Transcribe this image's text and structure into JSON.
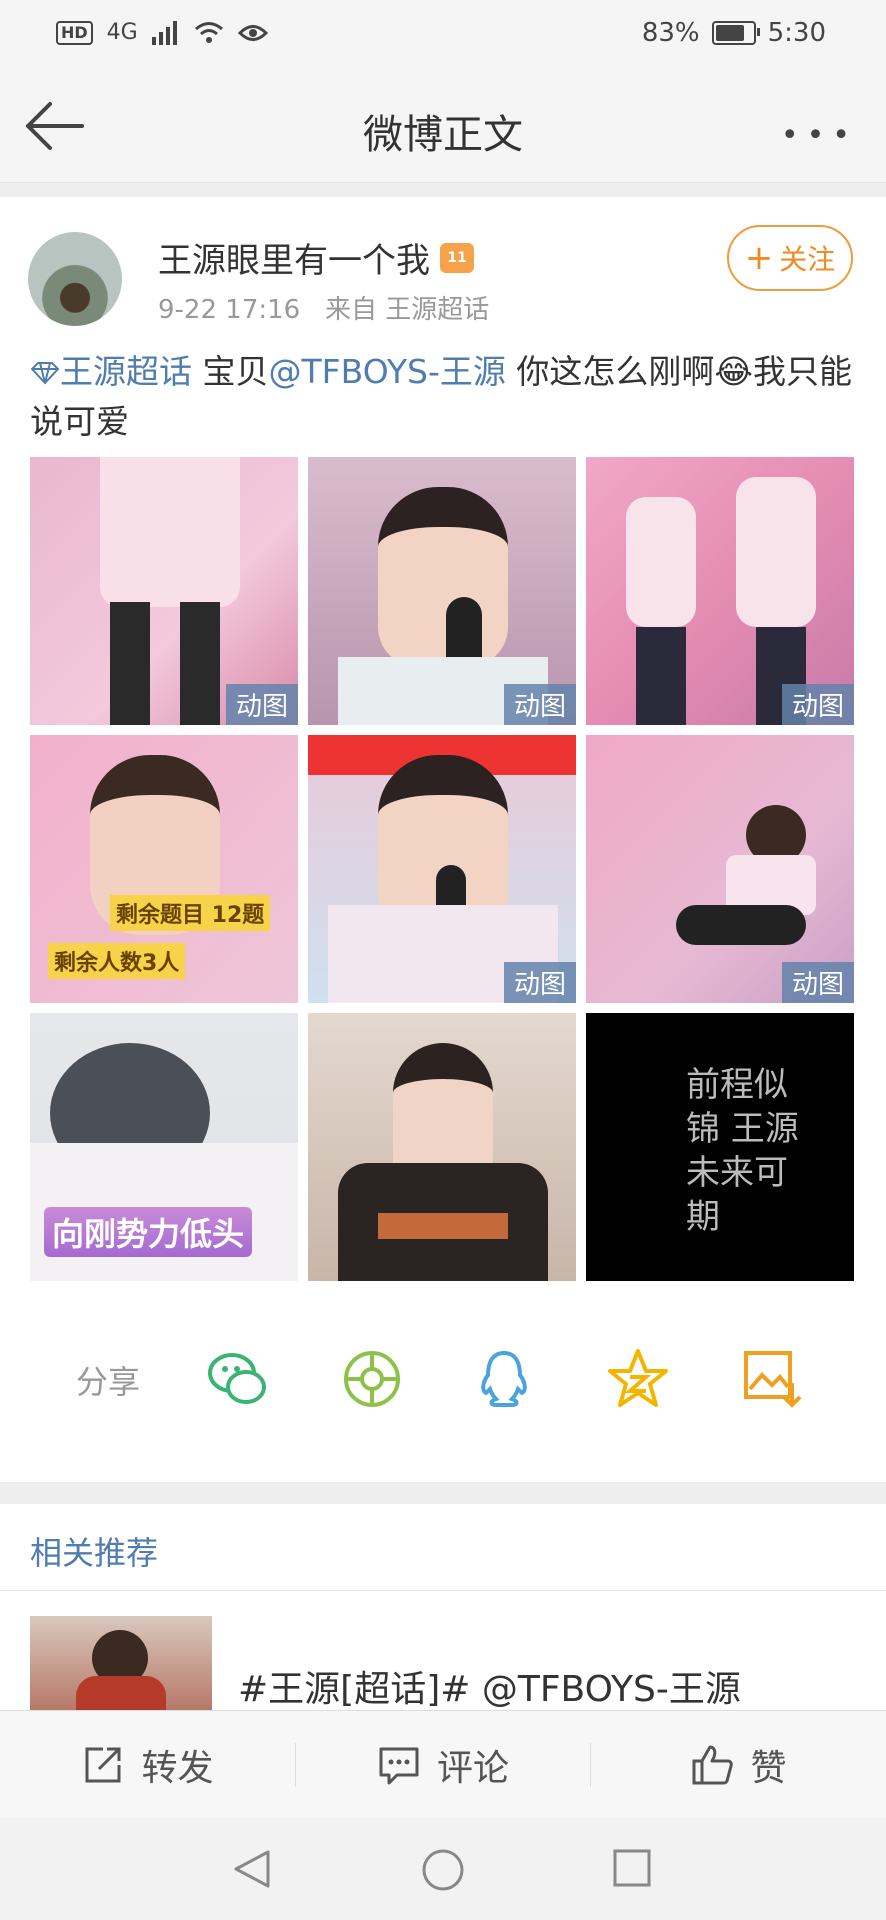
{
  "status_bar": {
    "hd": "HD",
    "network": "4G",
    "battery_percent": "83%",
    "battery_level": 0.83,
    "time": "5:30"
  },
  "nav": {
    "title": "微博正文"
  },
  "post": {
    "username": "王源眼里有一个我",
    "badge": "11",
    "time": "9-22 17:16",
    "source": "来自 王源超话",
    "follow_label": "关注",
    "topic_link": "王源超话",
    "text_before": " 宝贝",
    "mention": "@TFBOYS-王源",
    "text_after": " 你这怎么刚啊😂我只能说可爱",
    "images": [
      {
        "tag": "动图"
      },
      {
        "tag": "动图"
      },
      {
        "tag": "动图"
      },
      {
        "tag": "",
        "overlay1": "剩余题目 12题",
        "overlay2": "剩余人数3人"
      },
      {
        "tag": "动图"
      },
      {
        "tag": "动图"
      },
      {
        "tag": "",
        "caption": "向刚势力低头"
      },
      {
        "tag": ""
      },
      {
        "tag": "",
        "calligraphy": "前程似锦 王源 未来可期"
      }
    ]
  },
  "share": {
    "label": "分享",
    "icons": [
      "wechat-icon",
      "moments-icon",
      "qq-icon",
      "qzone-icon",
      "save-image-icon"
    ]
  },
  "recommend": {
    "title": "相关推荐",
    "item_text": "#王源[超话]# @TFBOYS-王源"
  },
  "actions": {
    "repost": "转发",
    "comment": "评论",
    "like": "赞"
  },
  "colors": {
    "link": "#507daf",
    "follow": "#f08a24",
    "wechat": "#3bb372",
    "moments": "#8cc24a",
    "qq": "#4aa3df",
    "qzone": "#f5b400"
  }
}
